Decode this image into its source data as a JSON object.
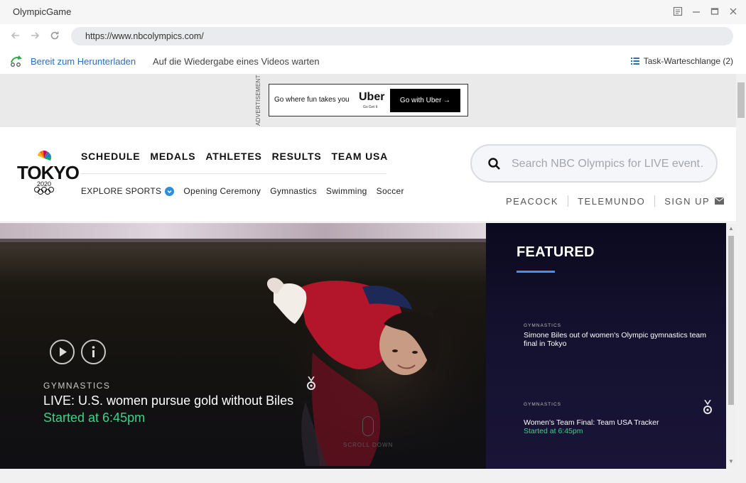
{
  "window": {
    "title": "OlympicGame"
  },
  "browser": {
    "url": "https://www.nbcolympics.com/"
  },
  "download_bar": {
    "status_ready": "Bereit zum Herunterladen",
    "status_waiting": "Auf die Wiedergabe eines Videos warten",
    "queue_label": "Task-Warteschlange (2)"
  },
  "ad": {
    "label": "ADVERTISEMENT",
    "tagline": "Go where fun takes you",
    "brand": "Uber",
    "brand_sub": "Go Get It",
    "cta": "Go with Uber →"
  },
  "header": {
    "logo_text": "TOKYO",
    "logo_year": "2020",
    "main_nav": [
      "SCHEDULE",
      "MEDALS",
      "ATHLETES",
      "RESULTS",
      "TEAM USA"
    ],
    "explore_label": "EXPLORE SPORTS",
    "sub_nav": [
      "Opening Ceremony",
      "Gymnastics",
      "Swimming",
      "Soccer"
    ],
    "search_placeholder": "Search NBC Olympics for LIVE event…",
    "account_links": [
      "PEACOCK",
      "TELEMUNDO",
      "SIGN UP"
    ]
  },
  "hero": {
    "category": "GYMNASTICS",
    "title": "LIVE: U.S. women pursue gold without Biles",
    "time": "Started at 6:45pm",
    "scroll_label": "SCROLL DOWN"
  },
  "featured": {
    "heading": "FEATURED",
    "items": [
      {
        "category": "GYMNASTICS",
        "headline": "Simone Biles out of women's Olympic gymnastics team final in Tokyo",
        "time": ""
      },
      {
        "category": "GYMNASTICS",
        "headline": "Women's Team Final: Team USA Tracker",
        "time": "Started at 6:45pm"
      }
    ]
  },
  "colors": {
    "accent_blue": "#1d6fbc",
    "live_green": "#3fd08a",
    "featured_bar": "#4a8ff0"
  }
}
